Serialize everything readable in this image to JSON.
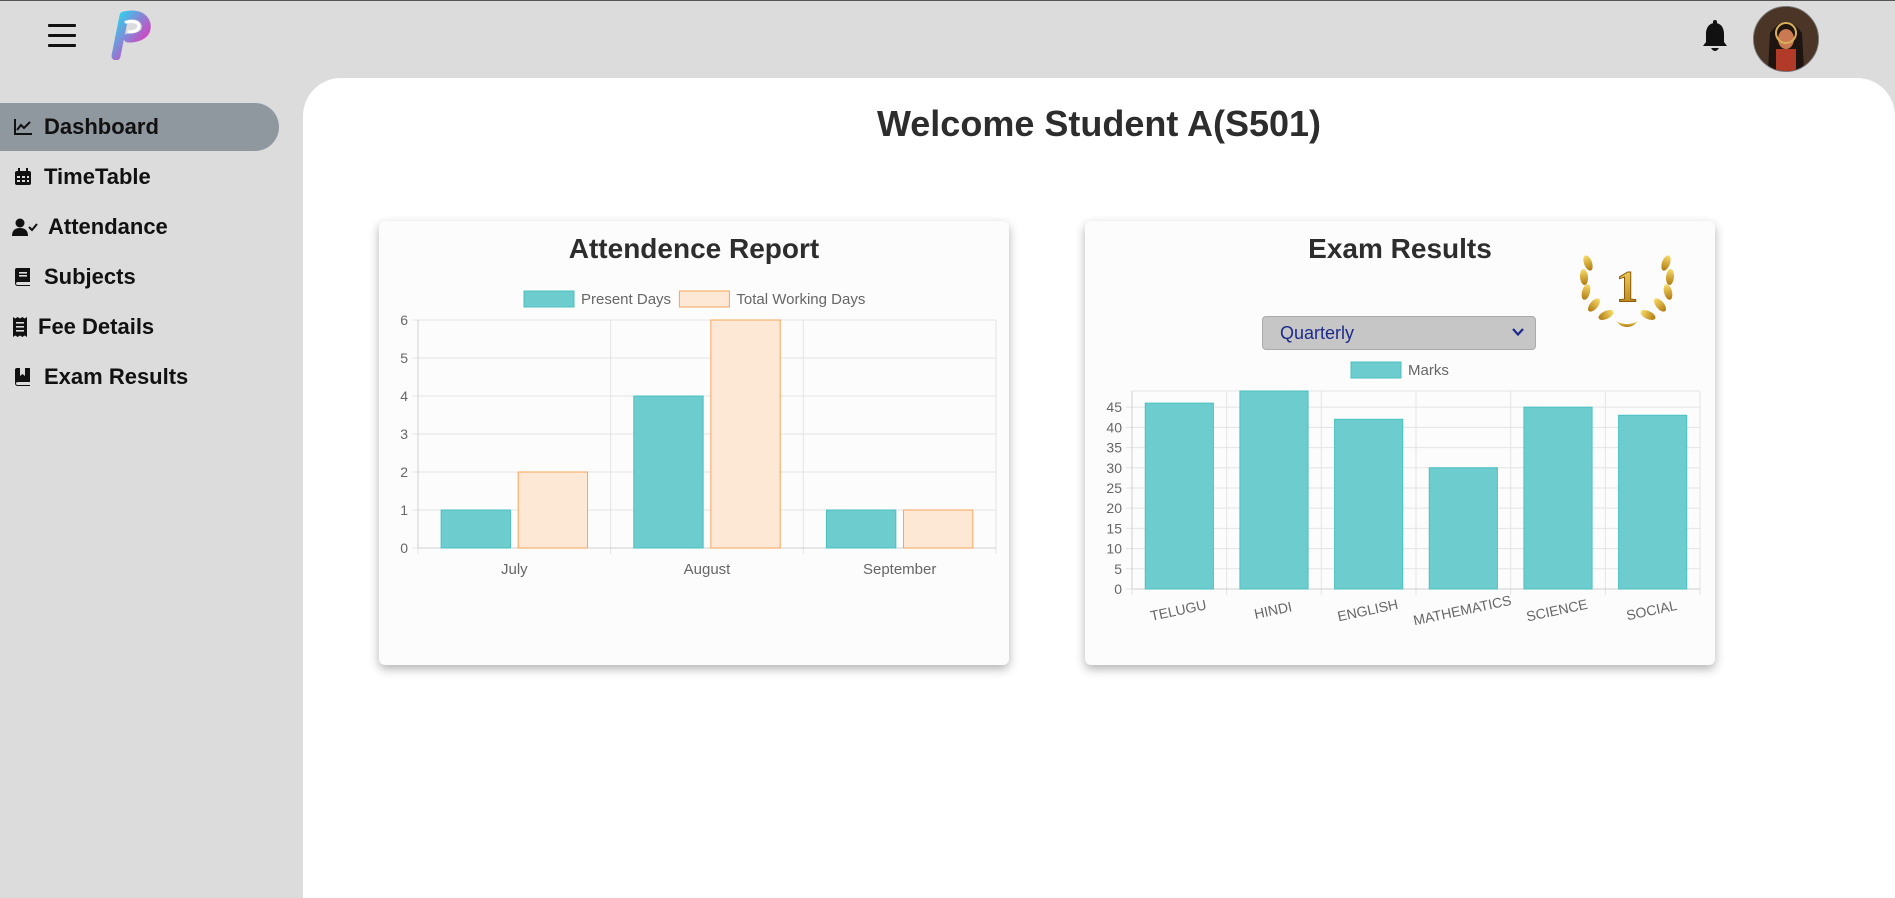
{
  "header": {
    "menu_icon": "hamburger-icon",
    "logo_icon": "app-logo-icon",
    "notification_icon": "bell-icon",
    "avatar_icon": "user-avatar-icon"
  },
  "sidebar": {
    "items": [
      {
        "label": "Dashboard",
        "icon": "line-chart-icon",
        "active": true
      },
      {
        "label": "TimeTable",
        "icon": "calendar-icon",
        "active": false
      },
      {
        "label": "Attendance",
        "icon": "user-check-icon",
        "active": false
      },
      {
        "label": "Subjects",
        "icon": "book-icon",
        "active": false
      },
      {
        "label": "Fee Details",
        "icon": "receipt-icon",
        "active": false
      },
      {
        "label": "Exam Results",
        "icon": "book-bookmark-icon",
        "active": false
      }
    ],
    "active_color": "#8f979f"
  },
  "main": {
    "welcome": "Welcome Student A(S501)",
    "attendance_card": {
      "title": "Attendence Report"
    },
    "exam_card": {
      "title": "Exam Results",
      "select_value": "Quarterly",
      "badge_text": "1",
      "badge_icon": "laurel-wreath-icon"
    }
  },
  "colors": {
    "teal": "#6dcdce",
    "teal_border": "#4bc0c0",
    "orange_fill": "#fde8d6",
    "orange_border": "#f5a55a",
    "panel": "#ffffff",
    "background": "#dcdcdc"
  },
  "chart_data": [
    {
      "type": "bar",
      "categories": [
        "July",
        "August",
        "September"
      ],
      "series": [
        {
          "name": "Present Days",
          "values": [
            1,
            4,
            1
          ]
        },
        {
          "name": "Total Working Days",
          "values": [
            2,
            6,
            1
          ]
        }
      ],
      "ylim": [
        0,
        6
      ],
      "yticks": [
        "0",
        "1",
        "2",
        "3",
        "4",
        "5",
        "6"
      ],
      "legend": "top",
      "grid": true
    },
    {
      "type": "bar",
      "categories": [
        "TELUGU",
        "HINDI",
        "ENGLISH",
        "MATHEMATICS",
        "SCIENCE",
        "SOCIAL"
      ],
      "series": [
        {
          "name": "Marks",
          "values": [
            46,
            49,
            42,
            30,
            45,
            43
          ]
        }
      ],
      "ylim": [
        0,
        49
      ],
      "yticks": [
        "0",
        "5",
        "10",
        "15",
        "20",
        "25",
        "30",
        "35",
        "40",
        "45"
      ],
      "legend": "top",
      "grid": true
    }
  ]
}
